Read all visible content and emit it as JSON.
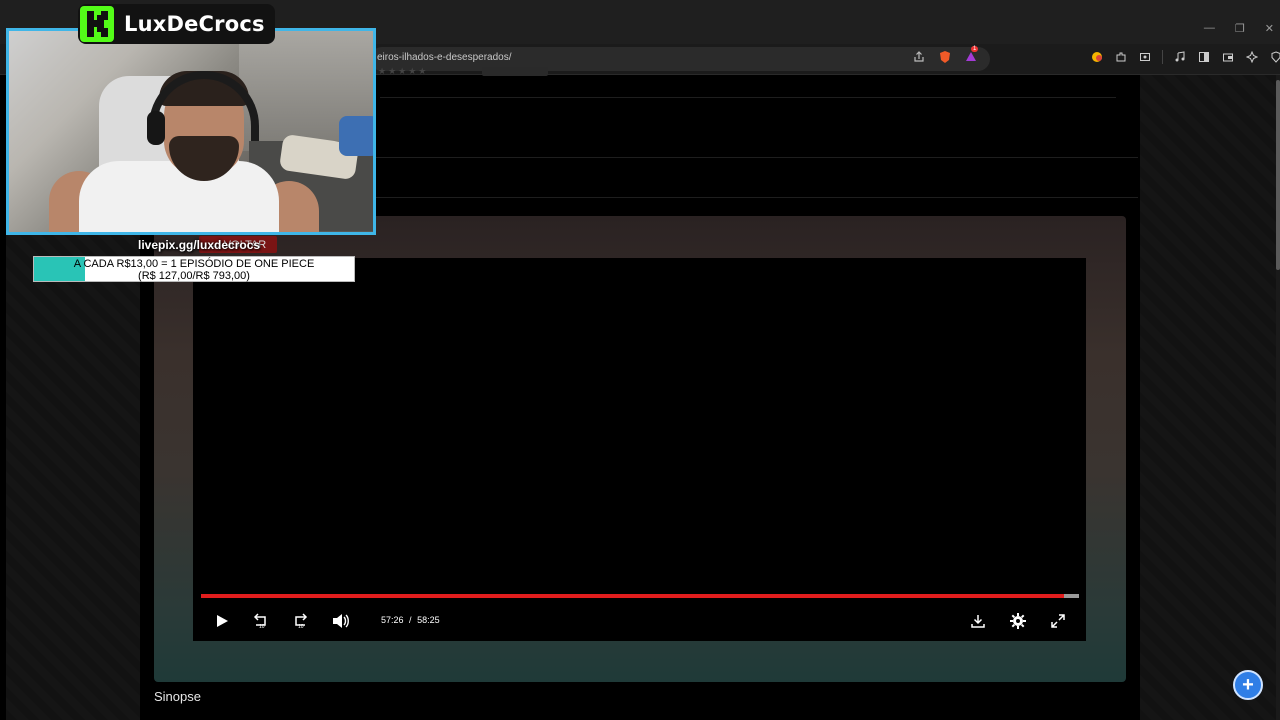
{
  "browser": {
    "url": "eiros-ilhados-e-desesperados/",
    "shield_badge": "",
    "alert_badge": "1"
  },
  "overlay": {
    "brand_name": "LuxDeCrocs",
    "livepix_url": "livepix.gg/luxdecrocs",
    "goal_line1": "A CADA R$13,00 = 1 EPISÓDIO DE ONE PIECE",
    "goal_line2": "(R$ 127,00/R$ 793,00)",
    "goal_progress": 0.16
  },
  "page": {
    "voltar_label": "VOLTAR",
    "sinopse_label": "Sinopse"
  },
  "player": {
    "current_time": "57:26",
    "separator": "/",
    "duration": "58:25",
    "progress": 0.983,
    "accent_color": "#e11d1d"
  }
}
